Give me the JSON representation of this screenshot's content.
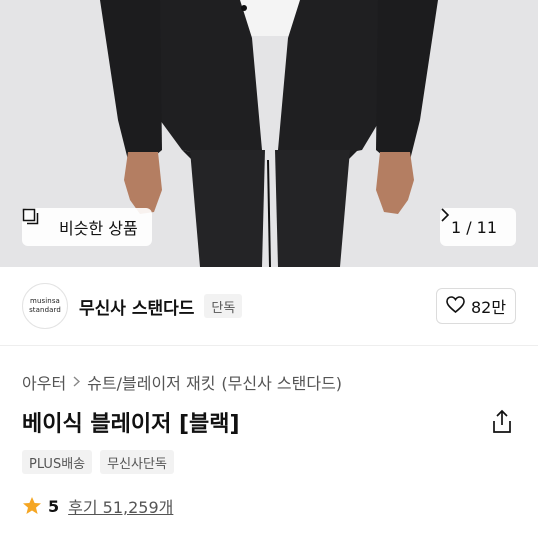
{
  "hero": {
    "similar_label": "비슷한 상품",
    "pager_current": "1",
    "pager_total": "11",
    "pager_text": "1 / 11"
  },
  "brand": {
    "logo_line1": "musinsa",
    "logo_line2": "standard",
    "name": "무신사 스탠다드",
    "tag": "단독",
    "likes": "82만"
  },
  "breadcrumb": {
    "items": [
      "아우터",
      "슈트/블레이저 재킷",
      "(무신사 스탠다드)"
    ]
  },
  "product": {
    "title": "베이식 블레이저 [블랙]",
    "badges": [
      "PLUS배송",
      "무신사단독"
    ]
  },
  "rating": {
    "score": "5",
    "reviews": "후기 51,259개"
  },
  "colors": {
    "accent_star": "#f5a623",
    "image_bg": "#e4e4e6",
    "suit": "#1f1f21"
  },
  "icons": {
    "similar": "similar-products-icon",
    "next": "chevron-right-icon",
    "like": "heart-outline-icon",
    "share": "share-icon",
    "star": "star-icon"
  }
}
